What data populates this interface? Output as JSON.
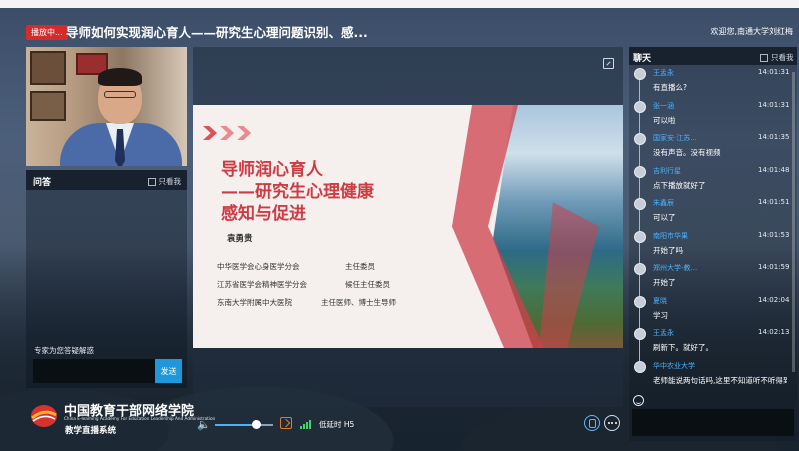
{
  "header": {
    "live_badge": "播放中...",
    "title": "导师如何实现润心育人——研究生心理问题识别、感...",
    "welcome": "欢迎您,南通大学刘红梅"
  },
  "qa": {
    "title": "问答",
    "only_me": "只看我",
    "hint": "专家为您答疑解惑",
    "input_value": "",
    "send_label": "发送"
  },
  "logo": {
    "name_cn": "中国教育干部网络学院",
    "name_en": "China E-learning Academy For Education Leadership And Administration",
    "system_name": "教学直播系统"
  },
  "slide": {
    "title_line1": "导师润心育人",
    "title_line2": "——研究生心理健康",
    "title_line3": "感知与促进",
    "author": "袁勇贵",
    "lines": [
      {
        "org": "中华医学会心身医学分会",
        "role": "主任委员"
      },
      {
        "org": "江苏省医学会精神医学分会",
        "role": "候任主任委员"
      },
      {
        "org": "东南大学附属中大医院",
        "role": "主任医师、博士生导师"
      }
    ]
  },
  "player": {
    "volume_level": 0.72,
    "latency_label": "低延时 H5"
  },
  "chat": {
    "title": "聊天",
    "only_me": "只看我",
    "messages": [
      {
        "name": "王孟永",
        "time": "14:01:31",
        "text": "有直播么?"
      },
      {
        "name": "张一涵",
        "time": "14:01:31",
        "text": "可以啦"
      },
      {
        "name": "国家安·江苏...",
        "time": "14:01:35",
        "text": "没有声音。没有视频"
      },
      {
        "name": "吉利行星",
        "time": "14:01:48",
        "text": "点下播放就好了"
      },
      {
        "name": "朱鑫辰",
        "time": "14:01:51",
        "text": "可以了"
      },
      {
        "name": "南阳市华果",
        "time": "14:01:53",
        "text": "开始了吗"
      },
      {
        "name": "郑州大学-教...",
        "time": "14:01:59",
        "text": "开始了"
      },
      {
        "name": "夏晓",
        "time": "14:02:04",
        "text": "学习"
      },
      {
        "name": "王孟永",
        "time": "14:02:13",
        "text": "刷新下。就好了。"
      },
      {
        "name": "华中农业大学",
        "time": "",
        "text": "老师能说两句话吗,这里不知道听不听得到"
      }
    ],
    "input_value": ""
  }
}
